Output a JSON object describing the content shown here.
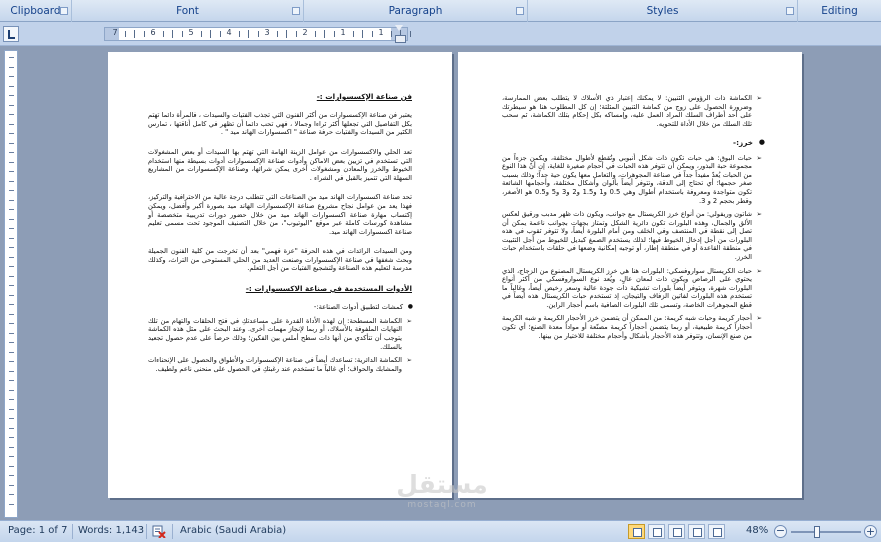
{
  "ribbon": {
    "clipboard": "Clipboard",
    "font": "Font",
    "paragraph": "Paragraph",
    "styles": "Styles",
    "editing": "Editing"
  },
  "ruler": {
    "numbers": [
      "7",
      "6",
      "5",
      "4",
      "3",
      "2",
      "1",
      "1"
    ]
  },
  "page_left": {
    "heading1": "فن صناعة الإكسسوارات :-",
    "p1": "يعتبر فن صناعة الإكسسوارات من أكثر الفنون التي تجذب الفتيات والسيدات ، فالمرأة دائما تهتم بكل التفاصيل التي تجعلها أكثر ثراءا وجمالا ، فهي تحب دائما أن تظهر في كامل أناقتها ، تمارس الكثير من السيدات والفتيات حرفة صناعة \" اكسسوارات الهاند ميد \" .",
    "p2": "تعد الحلي والاكسسوارات من عوامل الزينة الهامة التي تهتم بها السيدات أو بعض المشغولات التي تستخدم في تزيين بعض الاماكن وأدوات صناعة الإكسسوارات أدوات بسيطة منها استخدام الخيوط والخرز والمعادن ومشغولات أخرى يمكن شرائها، وصناعة الإكسسوارات من المشاريع السهلة التي تتميز بالقبل في الشراء .",
    "p3": "تحد صناعة اكسسوارات الهاند ميد من الصناعات التي تتطلب درجة عالية من الاحترافية والتركيز، فهذا يعد من عوامل نجاح مشروع صناعة الإكسسوارات الهاند ميد بصورة أكبر وأفضل، ويمكن إكتساب مهارة صناعة اكسسوارات الهاند ميد من خلال حضور دورات تدريبية متخصصة أو مشاهدة كورسات كاملة عبر موقع \"اليوتيوب\"، من خلال التصنيف الموجود تحت مسمى تعليم صناعة اكسسوارات الهاند ميد.",
    "p4": "ومن السيدات الرائدات في هذه الحرفة \"عزة فهمي\" بعد أن تخرجت من كلية الفنون الجميلة وبحث شغفها في صناعة الإكسسوارات وصنعت العديد من الحلي المستوحى من التراث، وكذلك مدرسة لتعليم هذه الصناعة ولتشجيع الفتيات من أجل التعلم.",
    "heading2": "الأدوات المستخدمة في صناعة الاكسسوارات :-",
    "bullet1": "كمشات لتطبيق أدوات الصناعة:-",
    "sub1": "الكماشة المسطحة: إن لهذه الأداة القدرة على مساعدتكِ في فتح الحلقات والتهام من تلك النهايات الملفوفة بالأسلاك، أو ربما لإنجاز مهمات أخرى. وعند البحث على مثل هذه الكماشة يتوجب أن تتأكدي من أنها ذات سطح أملس بين الفكين؛ وذلك حرصاً على عدم حصول تجعيد بالسلك.",
    "sub2": "الكماشة الدائرية: تساعدك أيضاً في صناعة الإكسسوارات والأطواق والحصول على الإنحناءات والمشابك والحواف؛ أي غالباً ما تستخدم عند رغبتكِ في الحصول على منحنى ناعم ولطيف."
  },
  "page_right": {
    "bullet_top": "الكماشة ذات الرؤوس الثنيين: لا يمكنك إعتبار ذي الأسلاك لا يتطلب بعض الممارسة، وضرورة الحصول على زوج من كماشة الثنيين المثلثة؛ إن كل المطلوب هنا هو سيطرتك على أحد أطراف السلك المراد العمل عليه، وإمساكه بكل إحكام بتلك الكماشة، ثم سحب تلك السلك من خلال الأداة للتحويه.",
    "heading": "خرز:-",
    "b1": "حبات البوق: هي حبات تكون ذات شكل أنبوبي وتُقطع لأطوال مختلفة، ويكمن جزءاً من مجموعة حبة البذور، ويمكن أن تتوفر هذه الحبات في أحجام صغيرة للغاية، إن أنّ هذا النوع من الحبات يُعدّ مفيداً جداً في صناعة المجوهرات، والتعامل معها يكون حية جداً؛ وذلك بسبب صغر حجمها؛ أي تحتاج إلى الدقة، وتتوفر أيضاً بألوان وأشكال مختلفة، وأحجامها الشائعة تكون متواجدة ومعروفة باستخدام أطوال وهي 0.5 و1 و1.5 و2 و3 و5 و0.5 هو الأصغر، وقطر بحجم 2 و 3.",
    "b2": "شاتون وريفولي: من أنواع خرز الكريستال مع جوانب، ويكون ذات ظهر مدبب ورقيق لعكس الألق والجمال، وهذه البلورات تكون دائرية الشكل وتمتاز بجهات بجوانب ناعمة يمكن أن تصل إلى نقطة في المنتصف وفي الخلف ومن أمام البلورة أيضاً، ولا تتوفر ثقوب في هذه البلورات من أجل إدخال الخيوط فيها؛ لذلك يستخدم الصمغ كبديل للخيوط من أجل التثبيت في منطقة القاعدة أو في منطقة إطار، أو توجيه إمكانية وضعها في حلقات باستخدام حبات الخرز.",
    "b3": "حبات الكريستال سواروفسكي: البلورات هنا هي خرز الكريستال المصنوع من الزجاج، الذي يحتوي على الرصاص ويكون ذات لمعان عالٍ، ويُعد نوع السواروفسكي من أكثر أنواع البلورات شهرة، ويتوفر أيضاً بلورات تشيكية ذات جودة عالية وسعر رخيص أيضاً، وغالباً ما تستخدم هذه البلورات لفاتين الزفاف والتيجان، إذ تستخدم حبات الكريستال هذه أيضاً في قطع المجوهرات الخاصة، وتسمى تلك البلورات الصافية باسم أحجار الراين.",
    "b4": "أحجار كريمة وحبات شبه كريمة: من الممكن أن يتضمن خرز الأحجار الكريمة و شبه الكريمة أحجاراً كريمة طبيعية، أو ربما يتضمن أحجاراً كريمة مصنّعة أو مواداً معدة الصنع؛ أي تكون من صنع الإنسان، وتتوفر هذه الأحجار بأشكال وأحجام مختلفة للاختيار من بينها."
  },
  "status": {
    "page": "Page: 1 of 7",
    "words": "Words: 1,143",
    "language": "Arabic (Saudi Arabia)",
    "zoom": "48%",
    "zoom_minus": "−",
    "zoom_plus": "+"
  },
  "watermark": {
    "text": "مستقل",
    "sub": "mostaql.com"
  },
  "zoom_level": 0.48
}
